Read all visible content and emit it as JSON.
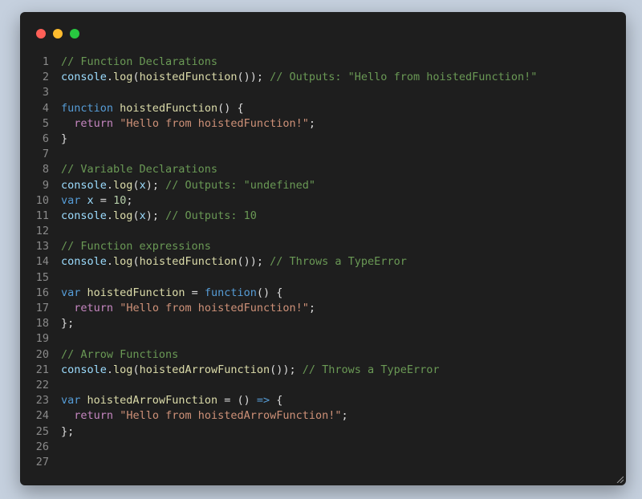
{
  "colors": {
    "traffic_red": "#fe5f57",
    "traffic_yellow": "#febc2e",
    "traffic_green": "#28c840",
    "comment": "#6a9955",
    "keyword_blue": "#569cd6",
    "keyword_purple": "#c586c0",
    "string": "#ce9178",
    "function": "#dcdcaa",
    "variable": "#9cdcfe",
    "number": "#b5cea8",
    "text": "#dcdcdc"
  },
  "window": {
    "controls": [
      "close",
      "minimize",
      "maximize"
    ]
  },
  "code": {
    "lines": [
      {
        "n": "1",
        "tokens": [
          {
            "t": "// Function Declarations",
            "c": "comment"
          }
        ]
      },
      {
        "n": "2",
        "tokens": [
          {
            "t": "console",
            "c": "variable"
          },
          {
            "t": ".",
            "c": "text"
          },
          {
            "t": "log",
            "c": "function"
          },
          {
            "t": "(",
            "c": "text"
          },
          {
            "t": "hoistedFunction",
            "c": "function"
          },
          {
            "t": "()); ",
            "c": "text"
          },
          {
            "t": "// Outputs: \"Hello from hoistedFunction!\"",
            "c": "comment"
          }
        ]
      },
      {
        "n": "3",
        "tokens": []
      },
      {
        "n": "4",
        "tokens": [
          {
            "t": "function",
            "c": "keyword_blue"
          },
          {
            "t": " ",
            "c": "text"
          },
          {
            "t": "hoistedFunction",
            "c": "function"
          },
          {
            "t": "() {",
            "c": "text"
          }
        ]
      },
      {
        "n": "5",
        "tokens": [
          {
            "t": "  ",
            "c": "text"
          },
          {
            "t": "return",
            "c": "keyword_purple"
          },
          {
            "t": " ",
            "c": "text"
          },
          {
            "t": "\"Hello from hoistedFunction!\"",
            "c": "string"
          },
          {
            "t": ";",
            "c": "text"
          }
        ]
      },
      {
        "n": "6",
        "tokens": [
          {
            "t": "}",
            "c": "text"
          }
        ]
      },
      {
        "n": "7",
        "tokens": []
      },
      {
        "n": "8",
        "tokens": [
          {
            "t": "// Variable Declarations",
            "c": "comment"
          }
        ]
      },
      {
        "n": "9",
        "tokens": [
          {
            "t": "console",
            "c": "variable"
          },
          {
            "t": ".",
            "c": "text"
          },
          {
            "t": "log",
            "c": "function"
          },
          {
            "t": "(",
            "c": "text"
          },
          {
            "t": "x",
            "c": "variable"
          },
          {
            "t": "); ",
            "c": "text"
          },
          {
            "t": "// Outputs: \"undefined\"",
            "c": "comment"
          }
        ]
      },
      {
        "n": "10",
        "tokens": [
          {
            "t": "var",
            "c": "keyword_blue"
          },
          {
            "t": " ",
            "c": "text"
          },
          {
            "t": "x",
            "c": "variable"
          },
          {
            "t": " = ",
            "c": "text"
          },
          {
            "t": "10",
            "c": "number"
          },
          {
            "t": ";",
            "c": "text"
          }
        ]
      },
      {
        "n": "11",
        "tokens": [
          {
            "t": "console",
            "c": "variable"
          },
          {
            "t": ".",
            "c": "text"
          },
          {
            "t": "log",
            "c": "function"
          },
          {
            "t": "(",
            "c": "text"
          },
          {
            "t": "x",
            "c": "variable"
          },
          {
            "t": "); ",
            "c": "text"
          },
          {
            "t": "// Outputs: 10",
            "c": "comment"
          }
        ]
      },
      {
        "n": "12",
        "tokens": []
      },
      {
        "n": "13",
        "tokens": [
          {
            "t": "// Function expressions",
            "c": "comment"
          }
        ]
      },
      {
        "n": "14",
        "tokens": [
          {
            "t": "console",
            "c": "variable"
          },
          {
            "t": ".",
            "c": "text"
          },
          {
            "t": "log",
            "c": "function"
          },
          {
            "t": "(",
            "c": "text"
          },
          {
            "t": "hoistedFunction",
            "c": "function"
          },
          {
            "t": "()); ",
            "c": "text"
          },
          {
            "t": "// Throws a TypeError",
            "c": "comment"
          }
        ]
      },
      {
        "n": "15",
        "tokens": []
      },
      {
        "n": "16",
        "tokens": [
          {
            "t": "var",
            "c": "keyword_blue"
          },
          {
            "t": " ",
            "c": "text"
          },
          {
            "t": "hoistedFunction",
            "c": "function"
          },
          {
            "t": " = ",
            "c": "text"
          },
          {
            "t": "function",
            "c": "keyword_blue"
          },
          {
            "t": "() {",
            "c": "text"
          }
        ]
      },
      {
        "n": "17",
        "tokens": [
          {
            "t": "  ",
            "c": "text"
          },
          {
            "t": "return",
            "c": "keyword_purple"
          },
          {
            "t": " ",
            "c": "text"
          },
          {
            "t": "\"Hello from hoistedFunction!\"",
            "c": "string"
          },
          {
            "t": ";",
            "c": "text"
          }
        ]
      },
      {
        "n": "18",
        "tokens": [
          {
            "t": "};",
            "c": "text"
          }
        ]
      },
      {
        "n": "19",
        "tokens": []
      },
      {
        "n": "20",
        "tokens": [
          {
            "t": "// Arrow Functions",
            "c": "comment"
          }
        ]
      },
      {
        "n": "21",
        "tokens": [
          {
            "t": "console",
            "c": "variable"
          },
          {
            "t": ".",
            "c": "text"
          },
          {
            "t": "log",
            "c": "function"
          },
          {
            "t": "(",
            "c": "text"
          },
          {
            "t": "hoistedArrowFunction",
            "c": "function"
          },
          {
            "t": "()); ",
            "c": "text"
          },
          {
            "t": "// Throws a TypeError",
            "c": "comment"
          }
        ]
      },
      {
        "n": "22",
        "tokens": []
      },
      {
        "n": "23",
        "tokens": [
          {
            "t": "var",
            "c": "keyword_blue"
          },
          {
            "t": " ",
            "c": "text"
          },
          {
            "t": "hoistedArrowFunction",
            "c": "function"
          },
          {
            "t": " = () ",
            "c": "text"
          },
          {
            "t": "=>",
            "c": "keyword_blue"
          },
          {
            "t": " {",
            "c": "text"
          }
        ]
      },
      {
        "n": "24",
        "tokens": [
          {
            "t": "  ",
            "c": "text"
          },
          {
            "t": "return",
            "c": "keyword_purple"
          },
          {
            "t": " ",
            "c": "text"
          },
          {
            "t": "\"Hello from hoistedArrowFunction!\"",
            "c": "string"
          },
          {
            "t": ";",
            "c": "text"
          }
        ]
      },
      {
        "n": "25",
        "tokens": [
          {
            "t": "};",
            "c": "text"
          }
        ]
      },
      {
        "n": "26",
        "tokens": []
      },
      {
        "n": "27",
        "tokens": []
      }
    ]
  }
}
